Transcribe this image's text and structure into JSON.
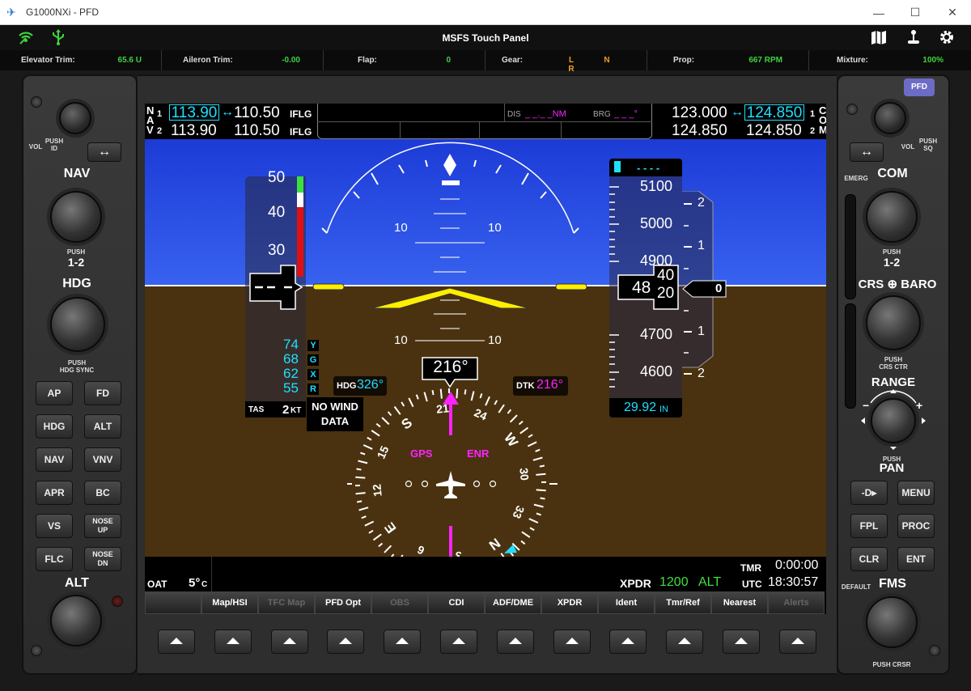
{
  "window": {
    "title": "G1000NXi - PFD",
    "minimize": "—",
    "maximize": "☐",
    "close": "✕"
  },
  "toolbar": {
    "title": "MSFS Touch Panel"
  },
  "status": {
    "elevator_trim_label": "Elevator Trim:",
    "elevator_trim_value": "65.6 U",
    "aileron_trim_label": "Aileron Trim:",
    "aileron_trim_value": "-0.00",
    "flap_label": "Flap:",
    "flap_value": "0",
    "gear_label": "Gear:",
    "gear_values": [
      "L",
      "N",
      "R"
    ],
    "prop_label": "Prop:",
    "prop_value": "667 RPM",
    "mixture_label": "Mixture:",
    "mixture_value": "100%"
  },
  "left_bezel": {
    "vol_label": "VOL",
    "push_id_label": "PUSH\nID",
    "nav_label": "NAV",
    "push_12_label": "PUSH",
    "n12": "1-2",
    "hdg_label": "HDG",
    "push_hdg_sync": "PUSH\nHDG SYNC",
    "alt_label": "ALT",
    "buttons": [
      {
        "id": "ap",
        "label": "AP"
      },
      {
        "id": "fd",
        "label": "FD"
      },
      {
        "id": "hdg",
        "label": "HDG"
      },
      {
        "id": "alt",
        "label": "ALT"
      },
      {
        "id": "nav",
        "label": "NAV"
      },
      {
        "id": "vnv",
        "label": "VNV"
      },
      {
        "id": "apr",
        "label": "APR"
      },
      {
        "id": "bc",
        "label": "BC"
      },
      {
        "id": "vs",
        "label": "VS"
      },
      {
        "id": "nose-up",
        "label": "NOSE\nUP"
      },
      {
        "id": "flc",
        "label": "FLC"
      },
      {
        "id": "nose-dn",
        "label": "NOSE\nDN"
      }
    ]
  },
  "right_bezel": {
    "pfd_label": "PFD",
    "vol_label": "VOL",
    "push_sq_label": "PUSH\nSQ",
    "emerg_label": "EMERG",
    "com_label": "COM",
    "push_label": "PUSH",
    "n12": "1-2",
    "crs_baro_label": "CRS ⊕ BARO",
    "push_crs_ctr": "PUSH\nCRS CTR",
    "range_label": "RANGE",
    "push_pan": "PUSH",
    "pan_label": "PAN",
    "fms_label": "FMS",
    "default_label": "DEFAULT",
    "push_crsr": "PUSH CRSR",
    "buttons": [
      {
        "id": "direct-to",
        "label": "-D▸"
      },
      {
        "id": "menu",
        "label": "MENU"
      },
      {
        "id": "fpl",
        "label": "FPL"
      },
      {
        "id": "proc",
        "label": "PROC"
      },
      {
        "id": "clr",
        "label": "CLR"
      },
      {
        "id": "ent",
        "label": "ENT"
      }
    ]
  },
  "pfd": {
    "nav1_tag": "N",
    "nav_a": "A",
    "nav_v": "V",
    "nav1_idx": "1",
    "nav2_idx": "2",
    "nav1_active": "113.90",
    "nav1_standby": "110.50",
    "nav1_ident": "IFLG",
    "nav2_active": "113.90",
    "nav2_standby": "110.50",
    "nav2_ident": "IFLG",
    "dis_label": "DIS",
    "dis_value": "_ _._ _NM",
    "brg_label": "BRG",
    "brg_value": "_ _ _°",
    "com1_active": "123.000",
    "com1_standby": "124.850",
    "com1_idx": "1",
    "com1_tag": "C",
    "com2_active": "124.850",
    "com2_standby": "124.850",
    "com2_idx": "2",
    "com2_tag": "M",
    "com_o": "O",
    "pitch_labels": [
      "10",
      "10",
      "10",
      "10"
    ],
    "airspeed_ticks": [
      "50",
      "40",
      "30"
    ],
    "airspeed_value": "",
    "vspeeds": [
      {
        "value": "74",
        "tag": "Y"
      },
      {
        "value": "68",
        "tag": "G"
      },
      {
        "value": "62",
        "tag": "X"
      },
      {
        "value": "55",
        "tag": "R"
      }
    ],
    "tas_label": "TAS",
    "tas_value": "2",
    "tas_unit": "KT",
    "wind_text": "NO WIND\nDATA",
    "selected_alt": "- - - -",
    "alt_ticks": [
      "5100",
      "5000",
      "4900",
      "4700",
      "4600"
    ],
    "alt_current_big": "48",
    "alt_roll_top": "40",
    "alt_roll_bottom": "20",
    "vsi_scale": [
      "2",
      "1",
      "1",
      "2"
    ],
    "vsi_value": "0",
    "baro_value": "29.92",
    "baro_unit": "IN",
    "hdg_bug_label": "HDG",
    "hdg_bug_value": "326°",
    "heading_value": "216°",
    "dtk_label": "DTK",
    "dtk_value": "216°",
    "compass_labels": [
      "21",
      "24",
      "W",
      "30",
      "33",
      "N",
      "3",
      "6",
      "E",
      "12",
      "15",
      "S"
    ],
    "gps_label": "GPS",
    "enr_label": "ENR",
    "oat_label": "OAT",
    "oat_value": "5°",
    "oat_unit": "C",
    "xpdr_label": "XPDR",
    "xpdr_code": "1200",
    "xpdr_mode": "ALT",
    "tmr_label": "TMR",
    "tmr_value": "0:00:00",
    "utc_label": "UTC",
    "utc_value": "18:30:57"
  },
  "softkeys": [
    {
      "id": "blank",
      "label": "",
      "dim": false
    },
    {
      "id": "map-hsi",
      "label": "Map/HSI",
      "dim": false
    },
    {
      "id": "tfc-map",
      "label": "TFC Map",
      "dim": true
    },
    {
      "id": "pfd-opt",
      "label": "PFD Opt",
      "dim": false
    },
    {
      "id": "obs",
      "label": "OBS",
      "dim": true
    },
    {
      "id": "cdi",
      "label": "CDI",
      "dim": false
    },
    {
      "id": "adf-dme",
      "label": "ADF/DME",
      "dim": false
    },
    {
      "id": "xpdr",
      "label": "XPDR",
      "dim": false
    },
    {
      "id": "ident",
      "label": "Ident",
      "dim": false
    },
    {
      "id": "tmr-ref",
      "label": "Tmr/Ref",
      "dim": false
    },
    {
      "id": "nearest",
      "label": "Nearest",
      "dim": false
    },
    {
      "id": "alerts",
      "label": "Alerts",
      "dim": true
    }
  ],
  "colors": {
    "sky": "#2a4ae0",
    "ground": "#4a3210",
    "cyan": "#1ee0ff",
    "magenta": "#ff22ff",
    "green": "#3ee03e",
    "gear_orange": "#f0a020"
  }
}
